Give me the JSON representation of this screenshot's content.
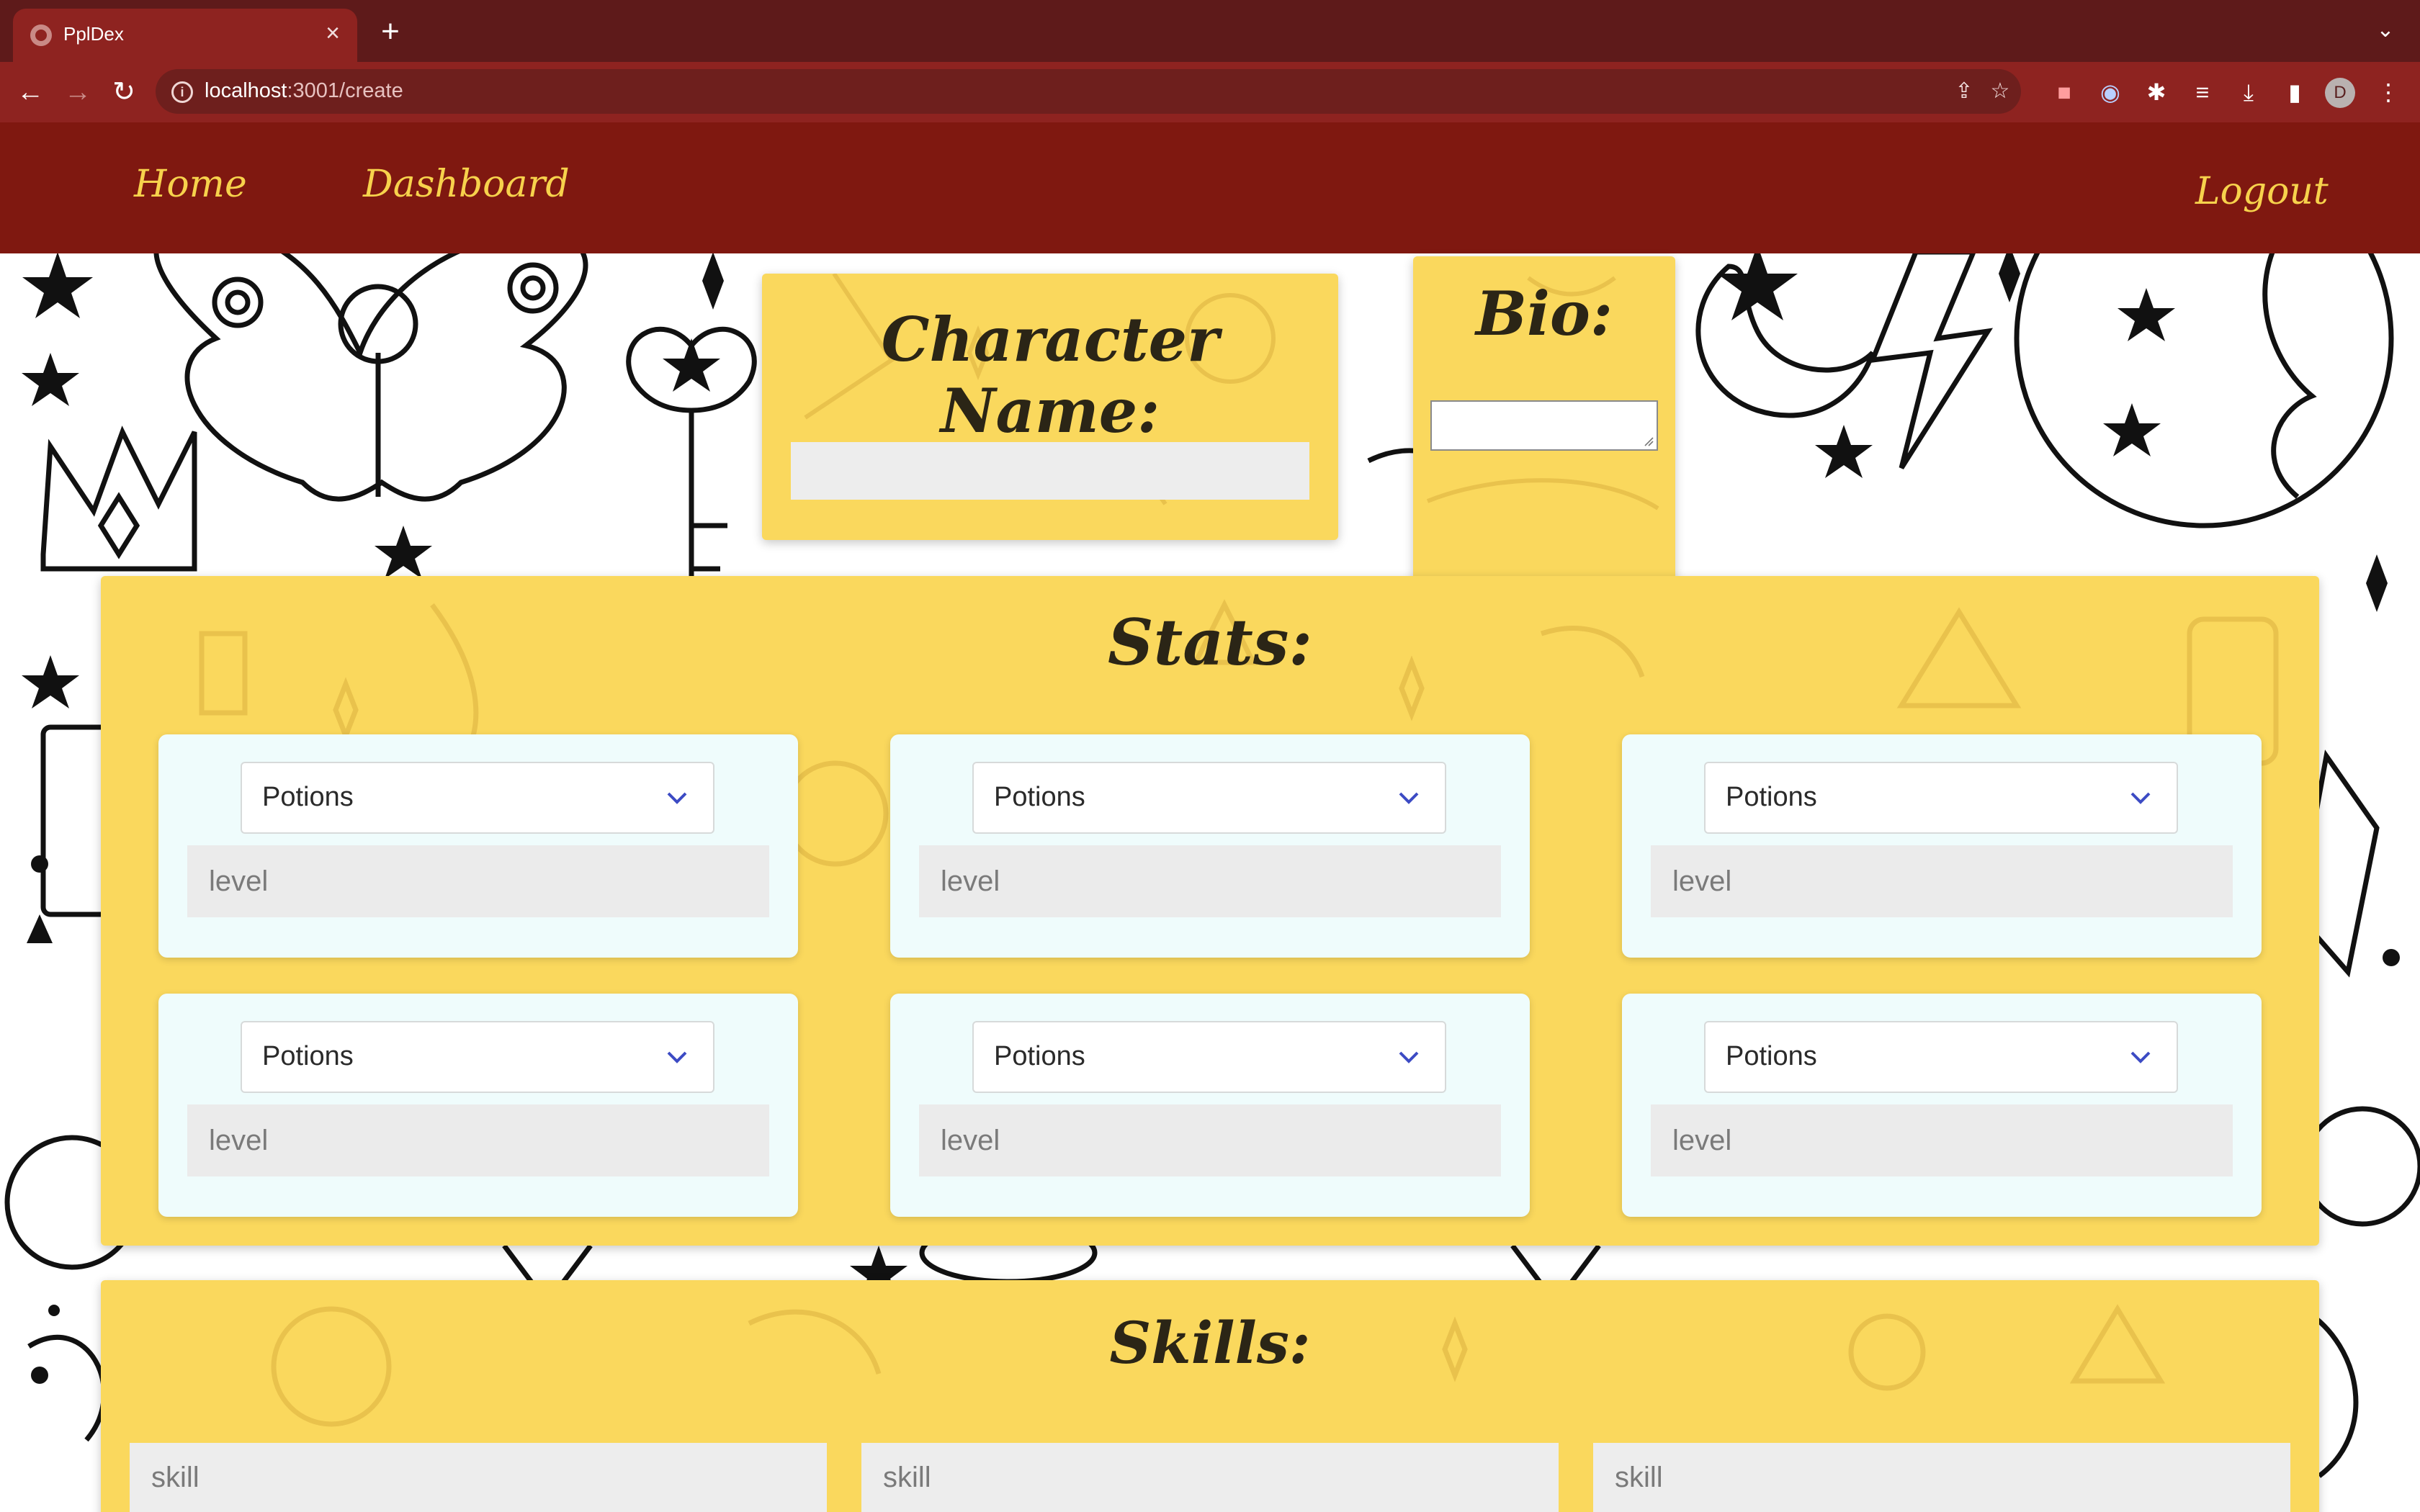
{
  "browser": {
    "tab_title": "PplDex",
    "url_host": "localhost",
    "url_path": ":3001/create",
    "profile_initial": "D"
  },
  "nav": {
    "home": "Home",
    "dashboard": "Dashboard",
    "logout": "Logout"
  },
  "character": {
    "heading": "Character Name:",
    "name_value": ""
  },
  "bio": {
    "heading": "Bio:",
    "value": ""
  },
  "stats": {
    "heading": "Stats:",
    "items": [
      {
        "select": "Potions",
        "level_placeholder": "level"
      },
      {
        "select": "Potions",
        "level_placeholder": "level"
      },
      {
        "select": "Potions",
        "level_placeholder": "level"
      },
      {
        "select": "Potions",
        "level_placeholder": "level"
      },
      {
        "select": "Potions",
        "level_placeholder": "level"
      },
      {
        "select": "Potions",
        "level_placeholder": "level"
      }
    ]
  },
  "skills": {
    "heading": "Skills:",
    "items": [
      {
        "placeholder": "skill"
      },
      {
        "placeholder": "skill"
      },
      {
        "placeholder": "skill"
      }
    ]
  },
  "colors": {
    "chrome_dark": "#5e1a1a",
    "chrome": "#8e2320",
    "site_nav": "#7f1810",
    "nav_text": "#f7d24c",
    "panel": "#fad85d",
    "card": "#effcfc",
    "chevron": "#3c4bc4"
  }
}
